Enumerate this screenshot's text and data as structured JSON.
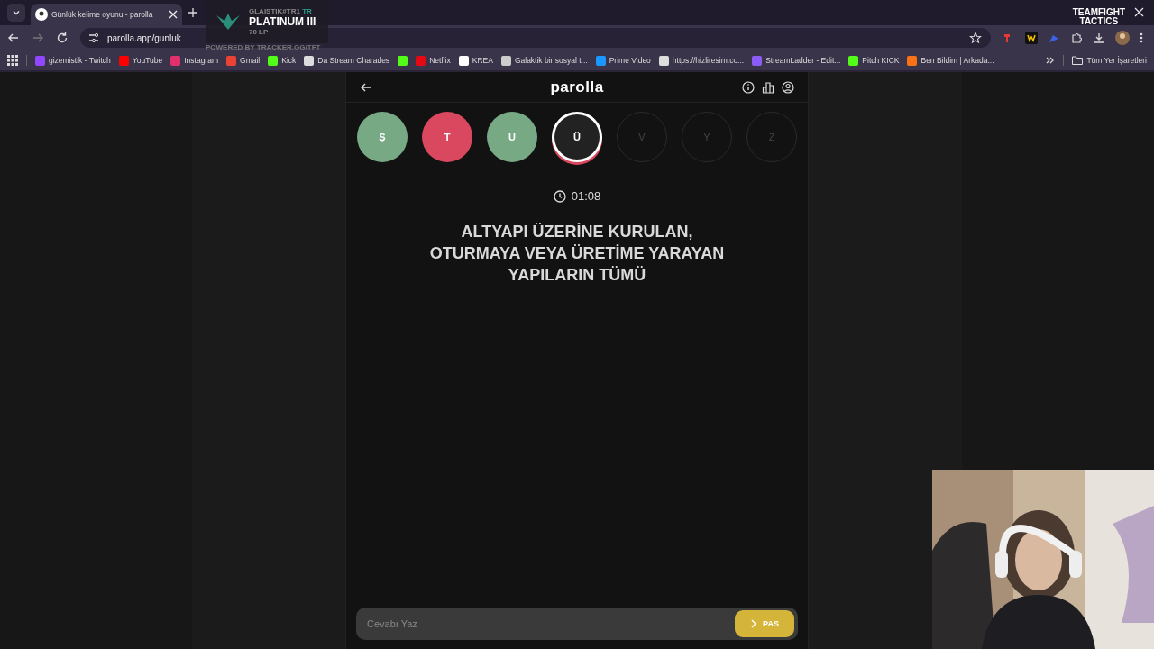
{
  "browser": {
    "tab": {
      "title": "Günlük kelime oyunu - parolla",
      "selected": true
    },
    "address": "parolla.app/gunluk",
    "bookmarks": [
      {
        "label": "gizemistik - Twitch",
        "color": "#9146ff"
      },
      {
        "label": "YouTube",
        "color": "#ff0000"
      },
      {
        "label": "Instagram",
        "color": "#e1306c"
      },
      {
        "label": "Gmail",
        "color": "#ea4335"
      },
      {
        "label": "Kick",
        "color": "#53fc18"
      },
      {
        "label": "Da Stream Charades",
        "color": "#dddddd"
      },
      {
        "color": "#53fc18"
      },
      {
        "label": "Netflix",
        "color": "#e50914"
      },
      {
        "label": "KREA",
        "color": "#ffffff"
      },
      {
        "label": "Galaktik bir sosyal t...",
        "color": "#cccccc"
      },
      {
        "label": "Prime Video",
        "color": "#1a98ff"
      },
      {
        "label": "https://hizliresim.co...",
        "color": "#dddddd"
      },
      {
        "label": "StreamLadder - Edit...",
        "color": "#8b5cf6"
      },
      {
        "label": "Pitch KICK",
        "color": "#53fc18"
      },
      {
        "label": "Ben Bildim | Arkada...",
        "color": "#f97316"
      }
    ],
    "all_bookmarks": "Tüm Yer İşaretleri"
  },
  "overlay": {
    "player": "GLAISTIK#TR1",
    "region": "TR",
    "rank": "PLATINUM III",
    "lp": "70 LP",
    "credit": "POWERED BY TRACKER.GG/TFT",
    "logo_line_1": "TEAMFIGHT",
    "logo_line_2": "TACTICS"
  },
  "game": {
    "title": "parolla",
    "letters": [
      {
        "letter": "Ş",
        "kind": "correct"
      },
      {
        "letter": "T",
        "kind": "wrong"
      },
      {
        "letter": "U",
        "kind": "correct"
      },
      {
        "letter": "Ü",
        "kind": "current"
      },
      {
        "letter": "V",
        "kind": "pending"
      },
      {
        "letter": "Y",
        "kind": "pending"
      },
      {
        "letter": "Z",
        "kind": "pending"
      }
    ],
    "timer": "01:08",
    "question_lines": [
      "ALTYAPI ÜZERİNE KURULAN,",
      "OTURMAYA VEYA ÜRETİME YARAYAN",
      "YAPILARIN TÜMÜ"
    ],
    "answer": {
      "placeholder": "Cevabı Yaz"
    },
    "pass_button": "PAS"
  }
}
